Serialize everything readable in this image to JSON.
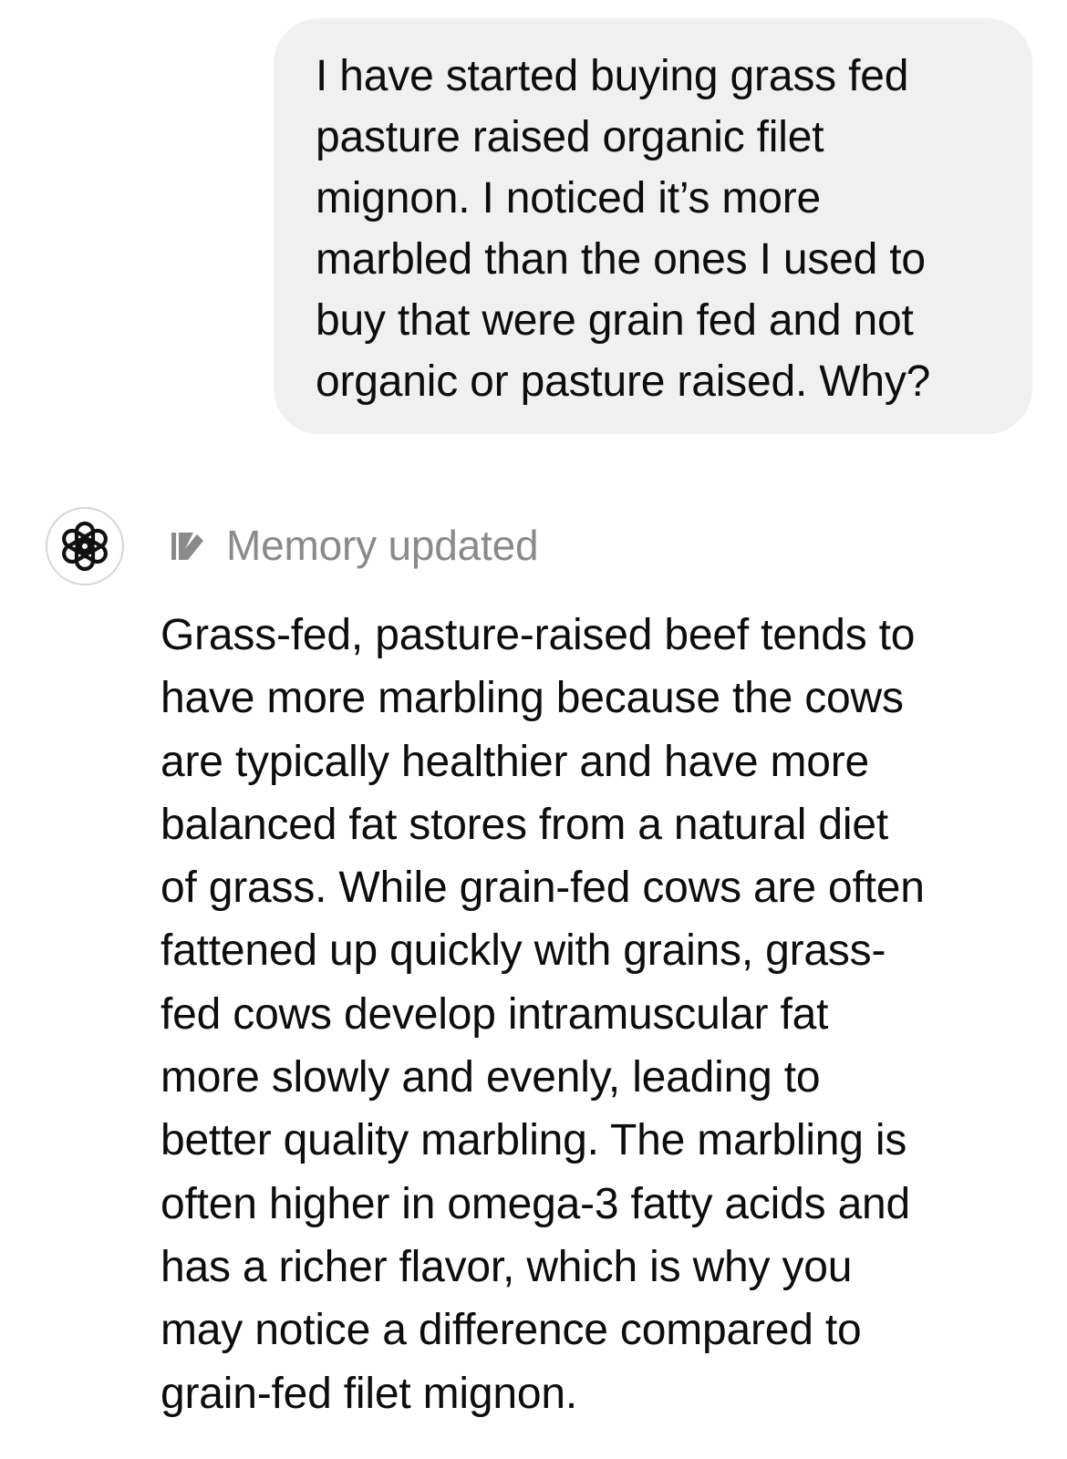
{
  "conversation": {
    "user_message": "I have started buying grass fed\npasture raised organic filet\nmignon. I noticed it’s more\nmarbled than the ones I used to\nbuy that were grain fed and not\norganic or pasture raised. Why?",
    "assistant": {
      "avatar_icon": "openai-logo-icon",
      "memory_icon": "memory-edit-icon",
      "memory_status": "Memory updated",
      "message": "Grass-fed, pasture-raised beef tends to\nhave more marbling because the cows\nare typically healthier and have more\nbalanced fat stores from a natural diet\nof grass. While grain-fed cows are often\nfattened up quickly with grains, grass-\nfed cows develop intramuscular fat\nmore slowly and evenly, leading to\nbetter quality marbling. The marbling is\noften higher in omega-3 fatty acids and\nhas a richer flavor, which is why you\nmay notice a difference compared to\ngrain-fed filet mignon."
    }
  },
  "colors": {
    "user_bubble": "#f0f0f0",
    "text": "#0d0d0d",
    "muted_text": "#8a8a8a",
    "avatar_border": "#d6d6d6"
  }
}
